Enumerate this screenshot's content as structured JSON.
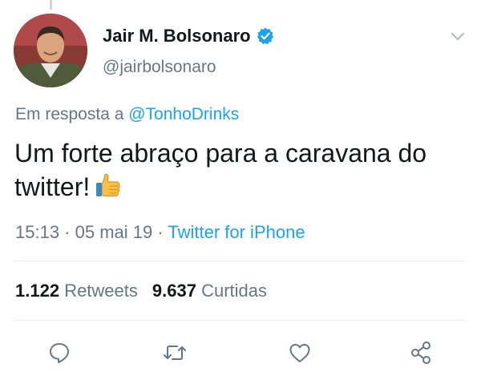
{
  "tweet": {
    "display_name": "Jair M. Bolsonaro",
    "handle": "@jairbolsonaro",
    "reply_prefix": "Em resposta a ",
    "reply_mention": "@TonhoDrinks",
    "text": "Um forte abraço para a caravana do twitter!",
    "timestamp": "15:13 · 05 mai 19 · ",
    "source": "Twitter for iPhone"
  },
  "stats": {
    "retweets_count": "1.122",
    "retweets_label": "Retweets",
    "likes_count": "9.637",
    "likes_label": "Curtidas"
  },
  "icons": {
    "verified": "verified-badge-icon",
    "more": "chevron-down-icon",
    "reply": "reply-icon",
    "retweet": "retweet-icon",
    "like": "heart-icon",
    "share": "share-icon",
    "emoji": "thumbs-up-emoji"
  },
  "colors": {
    "link": "#1da1f2",
    "secondary_text": "#657786",
    "primary_text": "#14171a",
    "divider": "#e6ecf0"
  }
}
